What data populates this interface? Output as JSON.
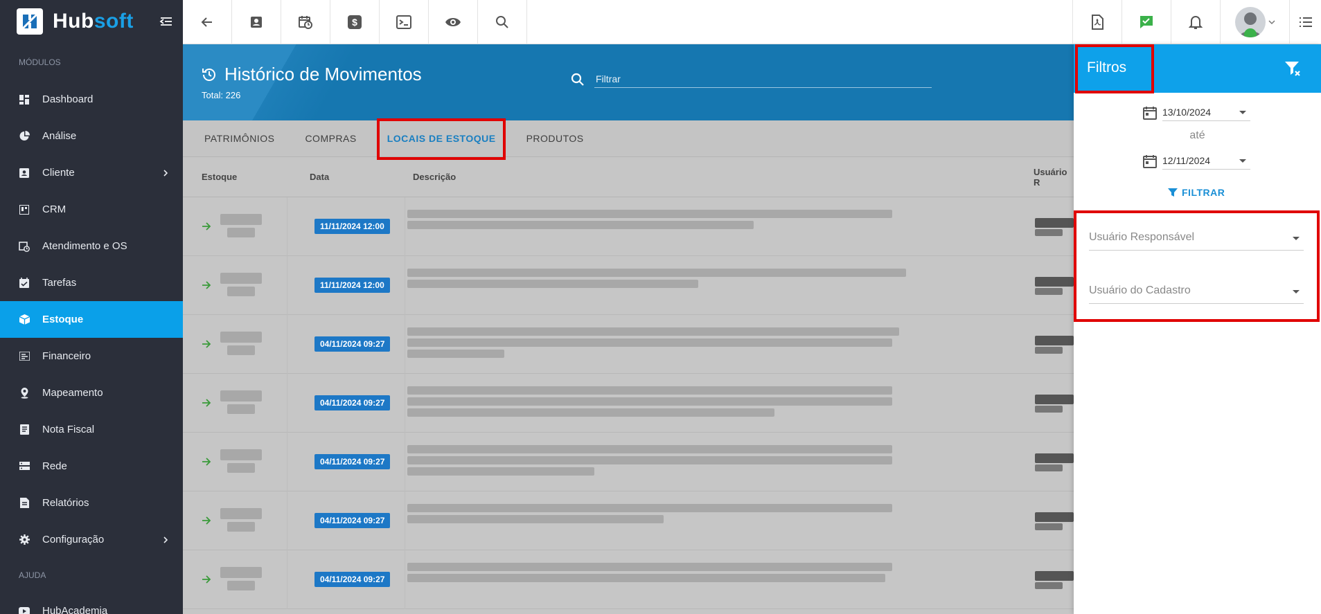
{
  "brand": {
    "name_part1": "Hub",
    "name_part2": "soft"
  },
  "sidebar": {
    "section_modules": "MÓDULOS",
    "section_help": "AJUDA",
    "items": [
      {
        "label": "Dashboard",
        "icon": "dashboard-icon"
      },
      {
        "label": "Análise",
        "icon": "pie-chart-icon"
      },
      {
        "label": "Cliente",
        "icon": "contact-card-icon",
        "has_children": true
      },
      {
        "label": "CRM",
        "icon": "crm-board-icon"
      },
      {
        "label": "Atendimento e OS",
        "icon": "calendar-clock-icon"
      },
      {
        "label": "Tarefas",
        "icon": "task-calendar-icon"
      },
      {
        "label": "Estoque",
        "icon": "box-icon",
        "active": true
      },
      {
        "label": "Financeiro",
        "icon": "money-icon"
      },
      {
        "label": "Mapeamento",
        "icon": "map-pin-icon"
      },
      {
        "label": "Nota Fiscal",
        "icon": "receipt-icon"
      },
      {
        "label": "Rede",
        "icon": "server-icon"
      },
      {
        "label": "Relatórios",
        "icon": "report-icon"
      },
      {
        "label": "Configuração",
        "icon": "gear-icon",
        "has_children": true
      }
    ],
    "help_items": [
      {
        "label": "HubAcademia",
        "icon": "play-icon"
      }
    ]
  },
  "page": {
    "title": "Histórico de Movimentos",
    "total": "Total: 226",
    "search_placeholder": "Filtrar"
  },
  "tabs": [
    {
      "label": "PATRIMÔNIOS"
    },
    {
      "label": "COMPRAS"
    },
    {
      "label": "LOCAIS DE ESTOQUE",
      "active": true
    },
    {
      "label": "PRODUTOS"
    }
  ],
  "table": {
    "headers": {
      "estoque": "Estoque",
      "data": "Data",
      "descricao": "Descrição",
      "usuario": "Usuário R"
    },
    "rows": [
      {
        "date": "11/11/2024 12:00"
      },
      {
        "date": "11/11/2024 12:00"
      },
      {
        "date": "04/11/2024 09:27"
      },
      {
        "date": "04/11/2024 09:27"
      },
      {
        "date": "04/11/2024 09:27"
      },
      {
        "date": "04/11/2024 09:27"
      },
      {
        "date": "04/11/2024 09:27"
      }
    ]
  },
  "filters": {
    "title": "Filtros",
    "date_from": "13/10/2024",
    "date_to": "12/11/2024",
    "between_label": "até",
    "apply_label": "FILTRAR",
    "user_responsible": "Usuário Responsável",
    "user_register": "Usuário do Cadastro"
  },
  "colors": {
    "accent": "#0aa0e9",
    "sidebar_bg": "#2b2f3a",
    "hero_bg": "#1677b0",
    "highlight": "#e00000",
    "badge": "#1d78c6"
  }
}
